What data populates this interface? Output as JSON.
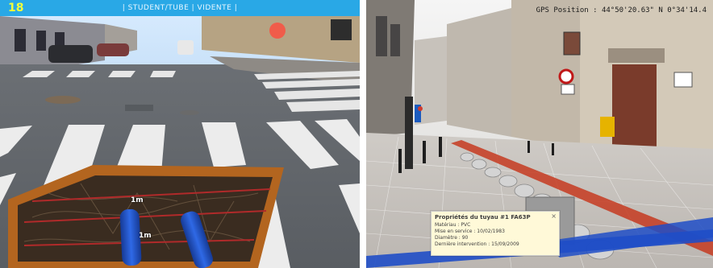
{
  "left_view": {
    "hud": {
      "indicator": "18",
      "title": "| STUDENT/TUBE | VIDENTE |"
    },
    "overlay": {
      "label_1": "1m",
      "label_2": "1m"
    }
  },
  "right_view": {
    "gps_text": "GPS Position : 44°50'20.63\" N 0°34'14.4",
    "popup": {
      "title": "Propriétés du tuyau #1 FA63P",
      "lines": [
        "Matériau : PVC",
        "Mise en service : 10/02/1983",
        "Diamètre : 90",
        "Dernière intervention : 15/09/2009"
      ]
    }
  },
  "colors": {
    "hud_bar": "#29a8e6",
    "hud_number": "#f2ff3a",
    "pipe_blue": "#1f4ec7",
    "pipe_red": "#c63a20",
    "trench_brown": "#b3651f"
  }
}
